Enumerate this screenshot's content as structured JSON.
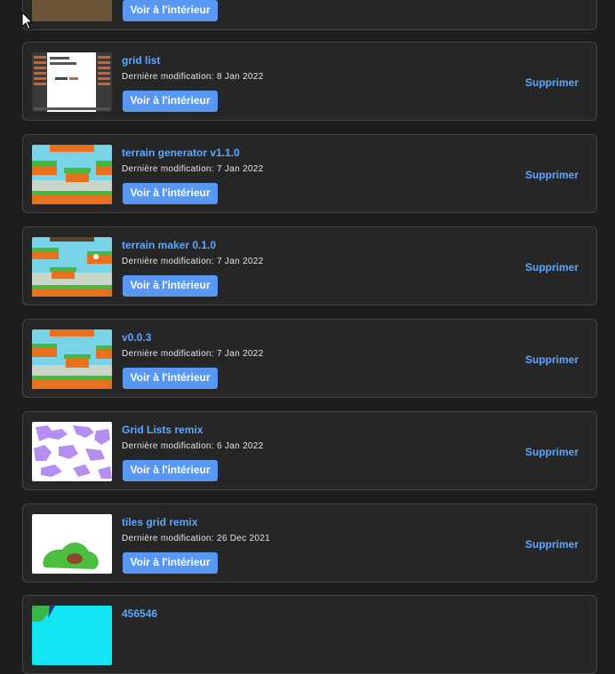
{
  "projects": [
    {
      "title": "",
      "date_label": "",
      "date_value": "",
      "open_label": "Voir à l'intérieur",
      "delete_label": "",
      "thumb": "brown"
    },
    {
      "title": "grid list",
      "date_label": "Dernière modification:",
      "date_value": "8 Jan 2022",
      "open_label": "Voir à l'intérieur",
      "delete_label": "Supprimer",
      "thumb": "grid-list"
    },
    {
      "title": "terrain generator v1.1.0",
      "date_label": "Dernière modification:",
      "date_value": "7 Jan 2022",
      "open_label": "Voir à l'intérieur",
      "delete_label": "Supprimer",
      "thumb": "terrain"
    },
    {
      "title": "terrain maker 0.1.0",
      "date_label": "Dernière modification:",
      "date_value": "7 Jan 2022",
      "open_label": "Voir à l'intérieur",
      "delete_label": "Supprimer",
      "thumb": "terrain"
    },
    {
      "title": "v0.0.3",
      "date_label": "Dernière modification:",
      "date_value": "7 Jan 2022",
      "open_label": "Voir à l'intérieur",
      "delete_label": "Supprimer",
      "thumb": "terrain"
    },
    {
      "title": "Grid Lists remix",
      "date_label": "Dernière modification:",
      "date_value": "6 Jan 2022",
      "open_label": "Voir à l'intérieur",
      "delete_label": "Supprimer",
      "thumb": "purple-blobs"
    },
    {
      "title": "tiles grid remix",
      "date_label": "Dernière modification:",
      "date_value": "26 Dec 2021",
      "open_label": "Voir à l'intérieur",
      "delete_label": "Supprimer",
      "thumb": "green-blob"
    },
    {
      "title": "456546",
      "date_label": "",
      "date_value": "",
      "open_label": "",
      "delete_label": "",
      "thumb": "cyan"
    }
  ],
  "colors": {
    "link": "#5ea8ff",
    "button": "#5898f4",
    "card_bg": "#262626",
    "page_bg": "#1e1e1e"
  }
}
